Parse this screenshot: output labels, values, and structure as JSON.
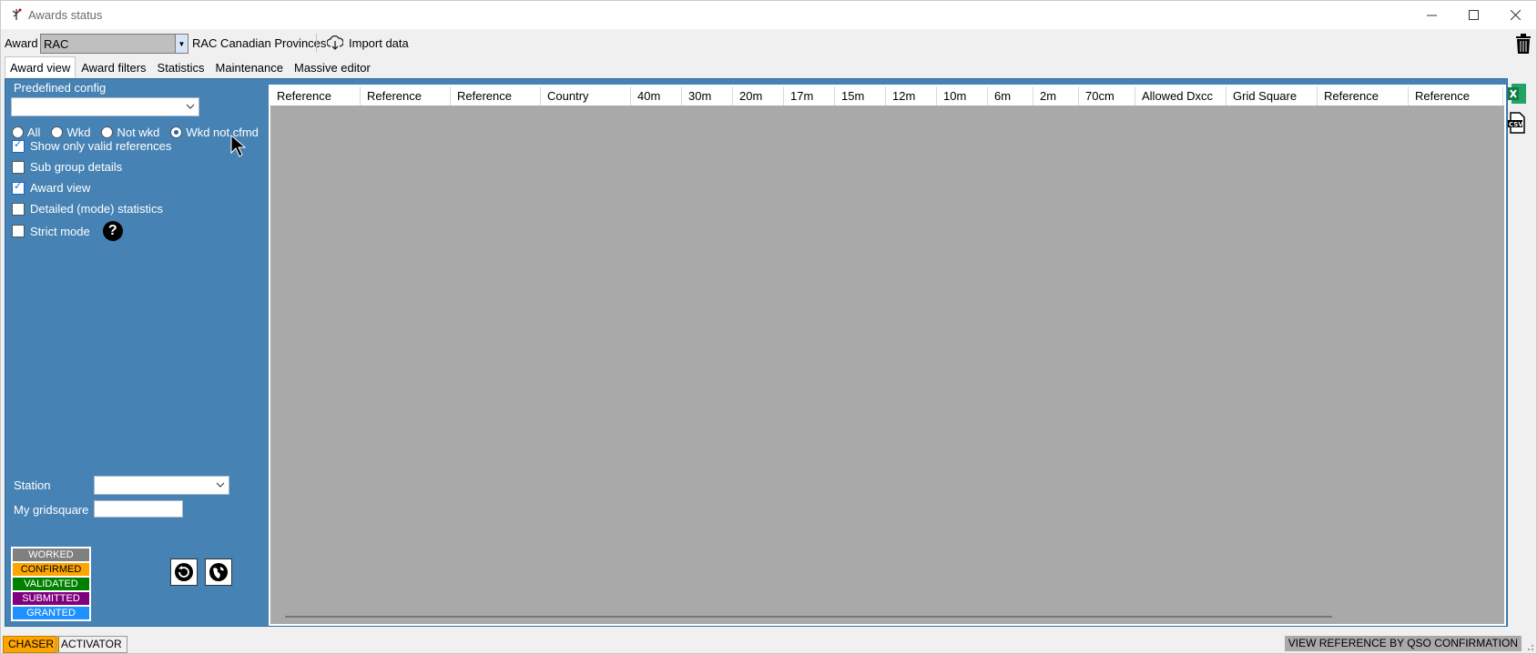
{
  "window": {
    "title": "Awards status"
  },
  "awardbar": {
    "award_label": "Award",
    "award_value": "RAC",
    "award_name": "RAC Canadian Provinces",
    "import_label": "Import data"
  },
  "tabs": [
    {
      "label": "Award view",
      "active": true
    },
    {
      "label": "Award filters",
      "active": false
    },
    {
      "label": "Statistics",
      "active": false
    },
    {
      "label": "Maintenance",
      "active": false
    },
    {
      "label": "Massive editor",
      "active": false
    }
  ],
  "left": {
    "predefined_label": "Predefined config",
    "predefined_value": "",
    "radios": [
      {
        "label": "All",
        "checked": false
      },
      {
        "label": "Wkd",
        "checked": false
      },
      {
        "label": "Not wkd",
        "checked": false
      },
      {
        "label": "Wkd not cfmd",
        "checked": true
      }
    ],
    "checkboxes": [
      {
        "label": "Show only valid references",
        "checked": true
      },
      {
        "label": "Sub group details",
        "checked": false
      },
      {
        "label": "Award view",
        "checked": true
      },
      {
        "label": "Detailed (mode) statistics",
        "checked": false
      },
      {
        "label": "Strict mode",
        "checked": false
      }
    ],
    "station_label": "Station",
    "station_value": "",
    "gridsquare_label": "My gridsquare",
    "gridsquare_value": "",
    "legend": [
      {
        "label": "WORKED",
        "color": "#808080",
        "text": "#ffffff"
      },
      {
        "label": "CONFIRMED",
        "color": "#ffa500",
        "text": "#000000"
      },
      {
        "label": "VALIDATED",
        "color": "#008000",
        "text": "#ffffff"
      },
      {
        "label": "SUBMITTED",
        "color": "#800080",
        "text": "#ffffff"
      },
      {
        "label": "GRANTED",
        "color": "#1e90ff",
        "text": "#ffffff"
      }
    ]
  },
  "grid": {
    "columns": [
      "Reference",
      "Reference",
      "Reference",
      "Country",
      "40m",
      "30m",
      "20m",
      "17m",
      "15m",
      "12m",
      "10m",
      "6m",
      "2m",
      "70cm",
      "Allowed Dxcc",
      "Grid Square",
      "Reference",
      "Reference"
    ]
  },
  "status": {
    "chaser": "CHASER",
    "activator": "ACTIVATOR",
    "view_reference": "VIEW REFERENCE BY QSO CONFIRMATION"
  },
  "colors": {
    "panel": "#4682b4",
    "grid_bg": "#a9a9a9",
    "chaser": "#ffa500"
  }
}
